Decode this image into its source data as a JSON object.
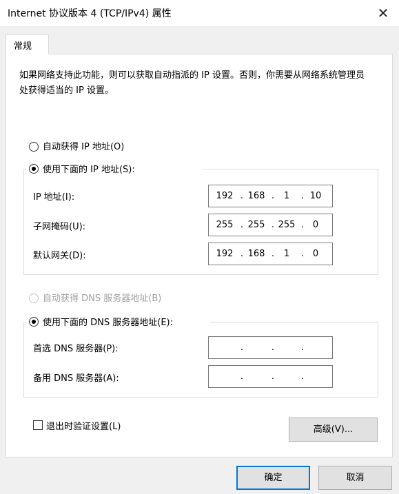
{
  "window": {
    "title": "Internet 协议版本 4 (TCP/IPv4) 属性",
    "close_glyph": "✕"
  },
  "tabs": [
    {
      "label": "常规"
    }
  ],
  "description": "如果网络支持此功能，则可以获取自动指派的 IP 设置。否则，你需要从网络系统管理员处获得适当的 IP 设置。",
  "ip": {
    "auto_label": "自动获得 IP 地址(O)",
    "manual_label": "使用下面的 IP 地址(S):",
    "selected": "manual",
    "fields": [
      {
        "label": "IP 地址(I):",
        "octets": [
          "192",
          "168",
          "1",
          "10"
        ]
      },
      {
        "label": "子网掩码(U):",
        "octets": [
          "255",
          "255",
          "255",
          "0"
        ]
      },
      {
        "label": "默认网关(D):",
        "octets": [
          "192",
          "168",
          "1",
          "0"
        ]
      }
    ]
  },
  "dns": {
    "auto_label": "自动获得 DNS 服务器地址(B)",
    "manual_label": "使用下面的 DNS 服务器地址(E):",
    "auto_disabled": true,
    "selected": "manual",
    "fields": [
      {
        "label": "首选 DNS 服务器(P):",
        "octets": [
          "",
          "",
          "",
          ""
        ]
      },
      {
        "label": "备用 DNS 服务器(A):",
        "octets": [
          "",
          "",
          "",
          ""
        ]
      }
    ]
  },
  "validate_on_exit": {
    "label": "退出时验证设置(L)",
    "checked": false
  },
  "buttons": {
    "advanced": "高级(V)...",
    "ok": "确定",
    "cancel": "取消"
  },
  "separator": ".",
  "colors": {
    "default_button_border": "#0078d7",
    "disabled_text": "#a0a0a0"
  }
}
